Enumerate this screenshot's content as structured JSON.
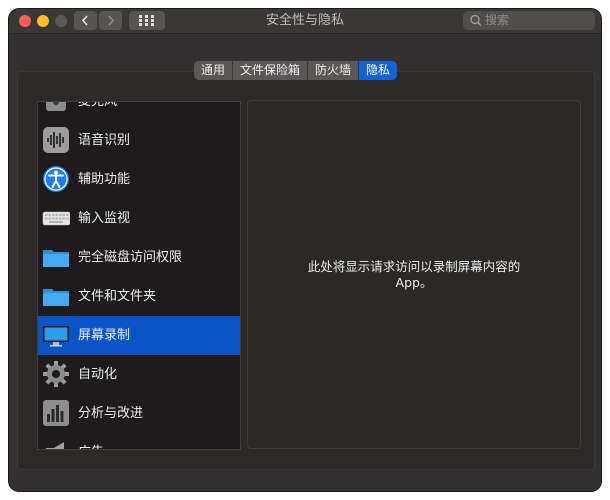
{
  "window": {
    "title": "安全性与隐私",
    "search_placeholder": "搜索",
    "traffic_lights": {
      "close": "#fe5f57",
      "minimize": "#febc2e",
      "zoom": "#5c5a59"
    },
    "nav_icons": {
      "back": "chevron-left-icon",
      "forward": "chevron-right-icon",
      "grid": "grid-icon",
      "search": "search-icon"
    }
  },
  "tabs": [
    {
      "label": "通用",
      "active": false
    },
    {
      "label": "文件保险箱",
      "active": false
    },
    {
      "label": "防火墙",
      "active": false
    },
    {
      "label": "隐私",
      "active": true
    }
  ],
  "sidebar": {
    "items": [
      {
        "label": "麦克风",
        "icon": "microphone-icon"
      },
      {
        "label": "语音识别",
        "icon": "speech-recognition-icon"
      },
      {
        "label": "辅助功能",
        "icon": "accessibility-icon"
      },
      {
        "label": "输入监视",
        "icon": "keyboard-icon"
      },
      {
        "label": "完全磁盘访问权限",
        "icon": "folder-icon"
      },
      {
        "label": "文件和文件夹",
        "icon": "folder-icon"
      },
      {
        "label": "屏幕录制",
        "icon": "display-icon",
        "selected": true
      },
      {
        "label": "自动化",
        "icon": "gear-icon"
      },
      {
        "label": "分析与改进",
        "icon": "chart-icon"
      },
      {
        "label": "广告",
        "icon": "megaphone-icon"
      }
    ]
  },
  "detail": {
    "message": "此处将显示请求访问以录制屏幕内容的 App。"
  },
  "colors": {
    "accent": "#0a54c8",
    "tab_active": "#1561d7",
    "window_bg": "#323030",
    "folder": "#3fa4e8"
  }
}
